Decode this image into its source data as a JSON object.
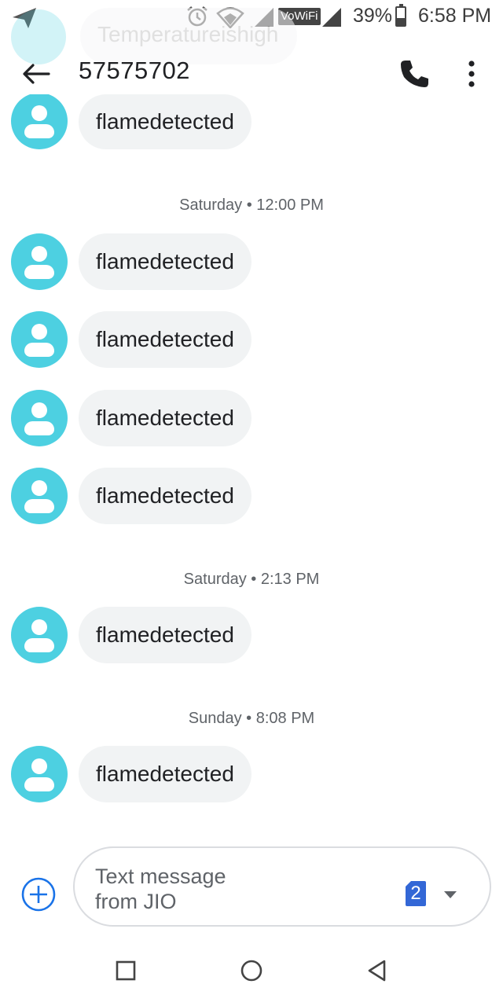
{
  "status_bar": {
    "vowifi": "VoWiFi",
    "battery_percent": "39%",
    "battery_level": 0.39,
    "time": "6:58 PM",
    "icons": [
      "send-icon",
      "alarm-icon",
      "wifi-icon",
      "signal-icon",
      "signal-icon",
      "battery-icon"
    ]
  },
  "scrolled_preview": "Temperatureishigh",
  "header": {
    "title": "57575702",
    "back_icon": "arrow-back-icon",
    "call_icon": "phone-icon",
    "menu_icon": "more-vert-icon"
  },
  "conversation": {
    "top_partial_message": "flamedetected",
    "groups": [
      {
        "timestamp": "Saturday • 12:00 PM",
        "messages": [
          "flamedetected",
          "flamedetected",
          "flamedetected",
          "flamedetected"
        ]
      },
      {
        "timestamp": "Saturday • 2:13 PM",
        "messages": [
          "flamedetected"
        ]
      },
      {
        "timestamp": "Sunday • 8:08 PM",
        "messages": [
          "flamedetected"
        ]
      }
    ]
  },
  "compose": {
    "placeholder": "Text message from JIO",
    "sim_number": "2",
    "add_icon": "add-circle-icon",
    "dropdown_icon": "arrow-drop-down-icon"
  },
  "nav_bar": [
    "recents-square-icon",
    "home-circle-icon",
    "back-triangle-icon"
  ],
  "colors": {
    "avatar": "#4dd0e1",
    "bubble": "#f1f3f4",
    "accent": "#1a73e8",
    "sim_badge": "#3367d6"
  }
}
